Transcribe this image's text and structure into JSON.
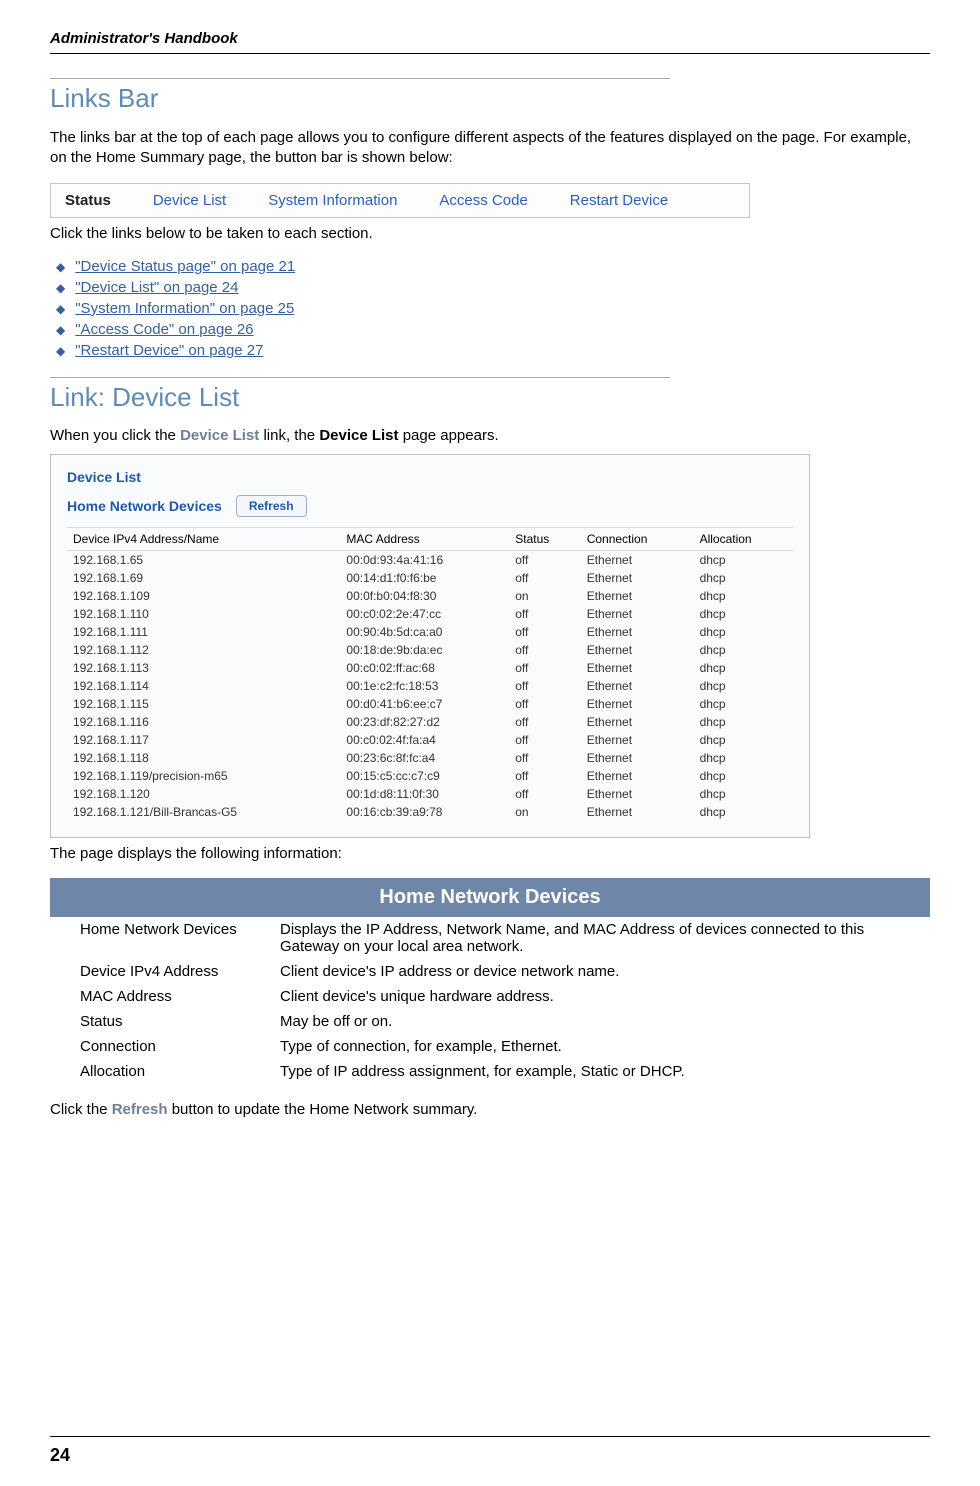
{
  "running_head": "Administrator's Handbook",
  "section1": {
    "title": "Links Bar",
    "para1": "The links bar at the top of each page allows you to configure different aspects of the features displayed on the page. For example, on the Home Summary page, the button bar is shown below:",
    "bar": {
      "status": "Status",
      "device_list": "Device List",
      "system_info": "System Information",
      "access_code": "Access Code",
      "restart": "Restart Device"
    },
    "click_text": "Click the links below to be taken to each section.",
    "bullets": [
      "\"Device Status page\" on page 21",
      "\"Device List\" on page 24",
      "\"System Information\" on page 25",
      "\"Access Code\" on page 26",
      "\"Restart Device\" on page 27"
    ]
  },
  "section2": {
    "title": "Link: Device List",
    "intro_pre": "When you click the ",
    "intro_gray": "Device List",
    "intro_mid": " link, the ",
    "intro_bold": "Device List",
    "intro_post": " page appears.",
    "panel": {
      "title": "Device List",
      "sub": "Home Network Devices",
      "refresh": "Refresh",
      "headers": [
        "Device IPv4 Address/Name",
        "MAC Address",
        "Status",
        "Connection",
        "Allocation"
      ],
      "rows": [
        [
          "192.168.1.65",
          "00:0d:93:4a:41:16",
          "off",
          "Ethernet",
          "dhcp"
        ],
        [
          "192.168.1.69",
          "00:14:d1:f0:f6:be",
          "off",
          "Ethernet",
          "dhcp"
        ],
        [
          "192.168.1.109",
          "00:0f:b0:04:f8:30",
          "on",
          "Ethernet",
          "dhcp"
        ],
        [
          "192.168.1.110",
          "00:c0:02:2e:47:cc",
          "off",
          "Ethernet",
          "dhcp"
        ],
        [
          "192.168.1.111",
          "00:90:4b:5d:ca:a0",
          "off",
          "Ethernet",
          "dhcp"
        ],
        [
          "192.168.1.112",
          "00:18:de:9b:da:ec",
          "off",
          "Ethernet",
          "dhcp"
        ],
        [
          "192.168.1.113",
          "00:c0:02:ff:ac:68",
          "off",
          "Ethernet",
          "dhcp"
        ],
        [
          "192.168.1.114",
          "00:1e:c2:fc:18:53",
          "off",
          "Ethernet",
          "dhcp"
        ],
        [
          "192.168.1.115",
          "00:d0:41:b6:ee:c7",
          "off",
          "Ethernet",
          "dhcp"
        ],
        [
          "192.168.1.116",
          "00:23:df:82:27:d2",
          "off",
          "Ethernet",
          "dhcp"
        ],
        [
          "192.168.1.117",
          "00:c0:02:4f:fa:a4",
          "off",
          "Ethernet",
          "dhcp"
        ],
        [
          "192.168.1.118",
          "00:23:6c:8f:fc:a4",
          "off",
          "Ethernet",
          "dhcp"
        ],
        [
          "192.168.1.119/precision-m65",
          "00:15:c5:cc:c7:c9",
          "off",
          "Ethernet",
          "dhcp"
        ],
        [
          "192.168.1.120",
          "00:1d:d8:11:0f:30",
          "off",
          "Ethernet",
          "dhcp"
        ],
        [
          "192.168.1.121/Bill-Brancas-G5",
          "00:16:cb:39:a9:78",
          "on",
          "Ethernet",
          "dhcp"
        ]
      ]
    },
    "after_panel": "The page displays the following information:",
    "hnd": {
      "header": "Home Network Devices",
      "rows": [
        [
          "Home Network Devices",
          "Displays the IP Address, Network Name, and MAC Address of devices connected to this Gateway on your local area network."
        ],
        [
          "Device IPv4 Address",
          "Client device's IP address or device network name."
        ],
        [
          "MAC Address",
          "Client device's unique hardware address."
        ],
        [
          "Status",
          "May be off or on."
        ],
        [
          "Connection",
          "Type of connection, for example, Ethernet."
        ],
        [
          "Allocation",
          "Type of IP address assignment, for example, Static or DHCP."
        ]
      ]
    },
    "closing_pre": "Click the ",
    "closing_btn": "Refresh",
    "closing_post": " button to update the Home Network summary."
  },
  "page_number": "24"
}
